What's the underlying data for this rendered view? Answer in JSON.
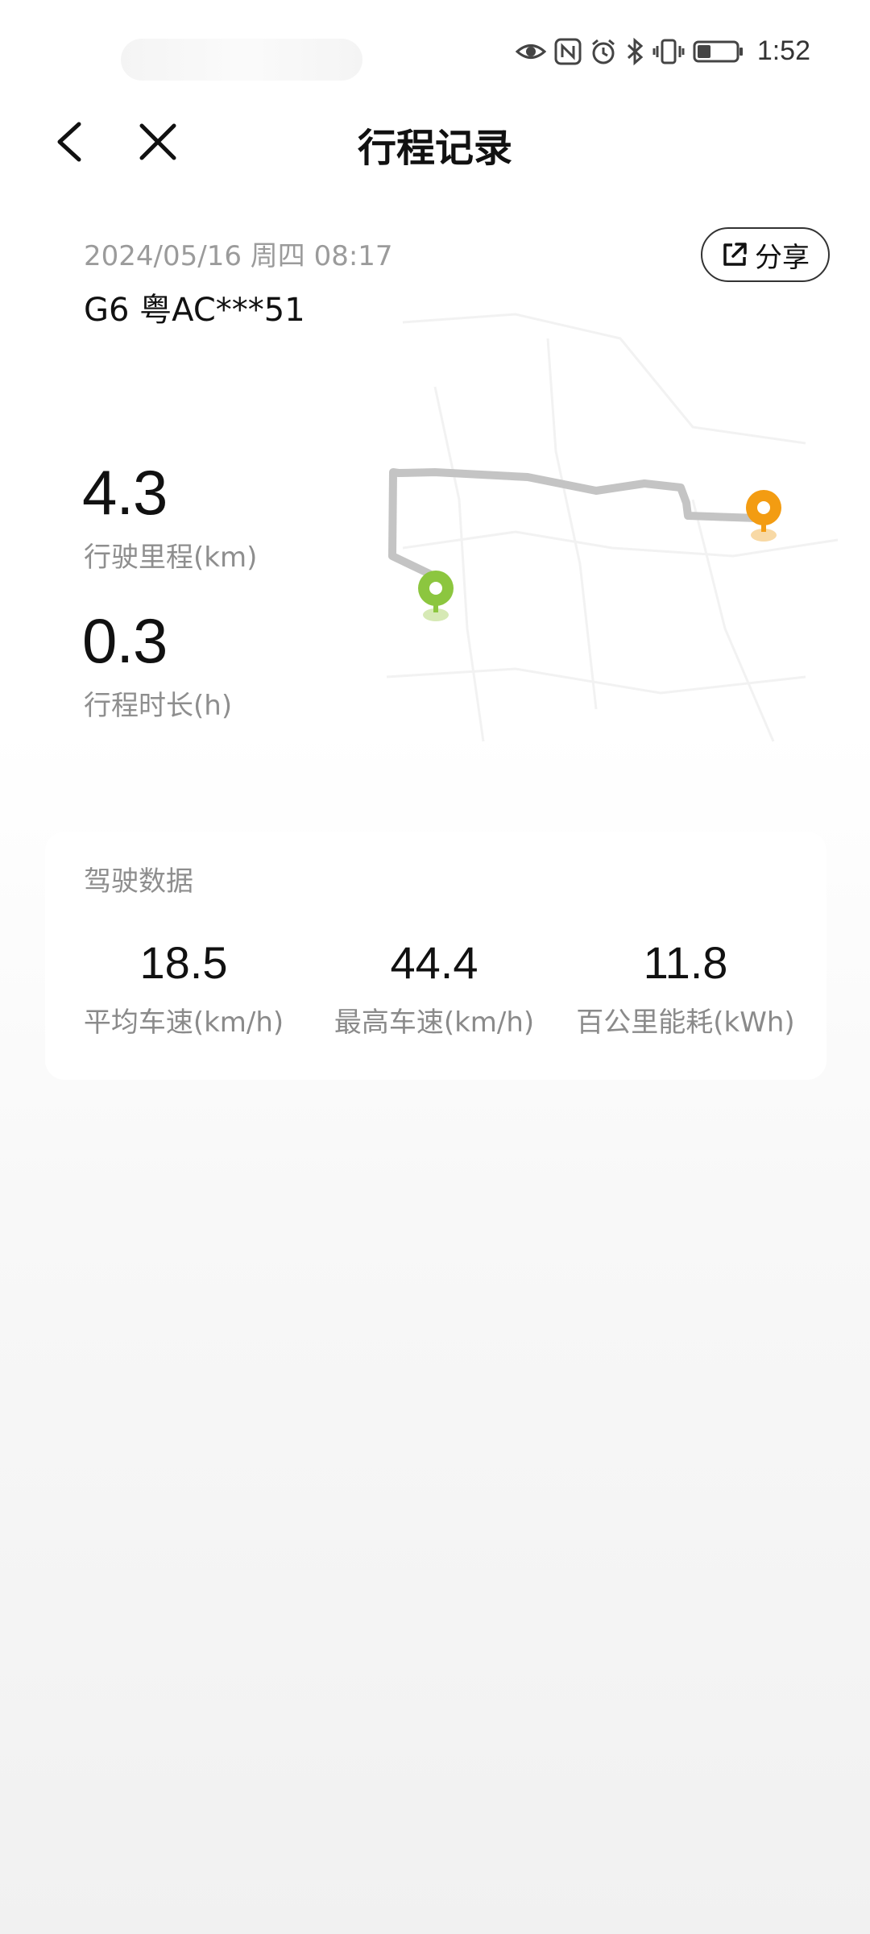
{
  "status_bar": {
    "time": "1:52",
    "icons": [
      "eye-icon",
      "nfc-icon",
      "alarm-icon",
      "bluetooth-icon",
      "vibrate-icon",
      "battery-icon"
    ]
  },
  "nav": {
    "title": "行程记录",
    "back_icon": "chevron-left-icon",
    "close_icon": "close-icon"
  },
  "trip": {
    "datetime": "2024/05/16 周四 08:17",
    "plate": "G6 粤AC***51",
    "share_label": "分享",
    "distance_value": "4.3",
    "distance_label": "行驶里程(km)",
    "duration_value": "0.3",
    "duration_label": "行程时长(h)"
  },
  "map": {
    "route_color": "#c4c4c4",
    "start_pin_color": "#8cc63f",
    "end_pin_color": "#f39c12"
  },
  "driving_data": {
    "title": "驾驶数据",
    "stats": [
      {
        "value": "18.5",
        "label": "平均车速(km/h)"
      },
      {
        "value": "44.4",
        "label": "最高车速(km/h)"
      },
      {
        "value": "11.8",
        "label": "百公里能耗(kWh)"
      }
    ]
  }
}
